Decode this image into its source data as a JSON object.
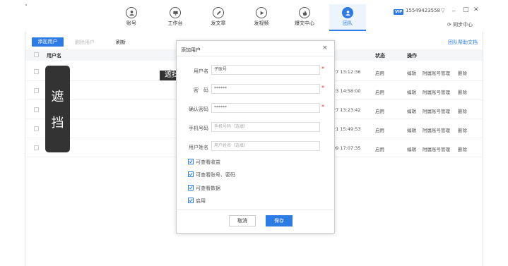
{
  "nav": {
    "items": [
      {
        "label": "账号",
        "icon": "user-icon"
      },
      {
        "label": "工作台",
        "icon": "desktop-icon"
      },
      {
        "label": "发文章",
        "icon": "pen-icon"
      },
      {
        "label": "发视频",
        "icon": "play-icon"
      },
      {
        "label": "爆文中心",
        "icon": "fire-icon"
      },
      {
        "label": "团队",
        "icon": "team-icon"
      }
    ],
    "active_index": 5
  },
  "account": {
    "vip": "VIP",
    "phone": "15549423558"
  },
  "window_controls": {
    "menu": "▽",
    "minimize": "_",
    "maximize": "□",
    "close": "✕"
  },
  "sync_label": "同步中心",
  "toolbar": {
    "add": "添加用户",
    "delete": "删除用户",
    "refresh": "刷新",
    "help": "团队帮助文档"
  },
  "table": {
    "headers": {
      "name": "用户名",
      "status": "状态",
      "action": "操作"
    },
    "rows": [
      {
        "time": "27 13:12:36",
        "status": "启用",
        "edit": "编辑",
        "manage": "附属账号管理",
        "delete": "删除"
      },
      {
        "time": "23 14:58:00",
        "status": "启用",
        "edit": "编辑",
        "manage": "附属账号管理",
        "delete": "删除"
      },
      {
        "time": "27 13:23:42",
        "status": "启用",
        "edit": "编辑",
        "manage": "附属账号管理",
        "delete": "删除"
      },
      {
        "time": "21 15:49:53",
        "status": "启用",
        "edit": "编辑",
        "manage": "附属账号管理",
        "delete": "删除"
      },
      {
        "time": "09 17:07:35",
        "status": "启用",
        "edit": "编辑",
        "manage": "附属账号管理",
        "delete": "删除"
      }
    ]
  },
  "mask": {
    "char1": "遮",
    "char2": "挡",
    "small": "遮挡"
  },
  "modal": {
    "title": "添加用户",
    "close": "×",
    "fields": [
      {
        "label": "用户名",
        "value": "子账号",
        "required": "*"
      },
      {
        "label": "密　码",
        "value": "******",
        "required": "*"
      },
      {
        "label": "确认密码",
        "value": "******",
        "required": "*"
      },
      {
        "label": "手机号码",
        "placeholder": "手机号码（选填）"
      },
      {
        "label": "用户姓名",
        "placeholder": "用户姓名（选填）"
      }
    ],
    "checkboxes": [
      {
        "label": "可查看收益"
      },
      {
        "label": "可查看账号、密码"
      },
      {
        "label": "可查看数据"
      },
      {
        "label": "启用"
      }
    ],
    "cancel": "取消",
    "save": "保存"
  },
  "colors": {
    "accent": "#2d7be5",
    "mask": "#333333"
  }
}
